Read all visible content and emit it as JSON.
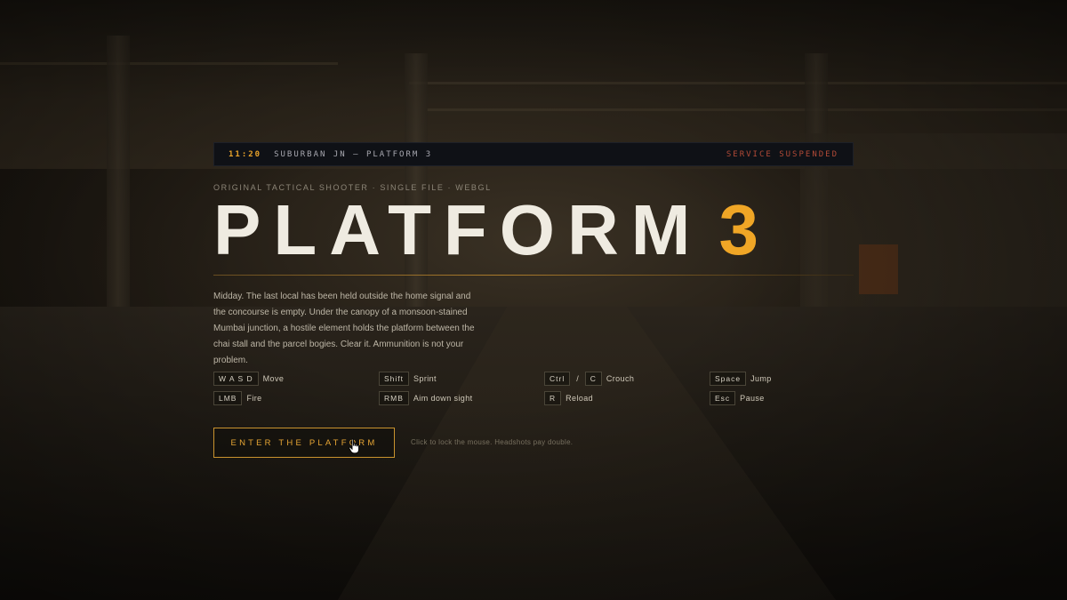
{
  "ticker": {
    "time": "11:20",
    "station": "SUBURBAN JN — PLATFORM 3",
    "status": "SERVICE SUSPENDED"
  },
  "kicker": "ORIGINAL TACTICAL SHOOTER · SINGLE FILE · WEBGL",
  "title": {
    "main": "PLATFORM",
    "number": "3"
  },
  "description": "Midday. The last local has been held outside the home signal and the concourse is empty. Under the canopy of a monsoon-stained Mumbai junction, a hostile element holds the platform between the chai stall and the parcel bogies. Clear it. Ammunition is not your problem.",
  "controls": [
    {
      "keys": [
        "W A S D"
      ],
      "action": "Move"
    },
    {
      "keys": [
        "Shift"
      ],
      "action": "Sprint"
    },
    {
      "keys": [
        "Ctrl",
        "C"
      ],
      "separator": "/",
      "action": "Crouch"
    },
    {
      "keys": [
        "Space"
      ],
      "action": "Jump"
    },
    {
      "keys": [
        "LMB"
      ],
      "action": "Fire"
    },
    {
      "keys": [
        "RMB"
      ],
      "action": "Aim down sight"
    },
    {
      "keys": [
        "R"
      ],
      "action": "Reload"
    },
    {
      "keys": [
        "Esc"
      ],
      "action": "Pause"
    }
  ],
  "cta": {
    "label": "ENTER THE PLATFORM"
  },
  "hint": "Click to lock the mouse. Headshots pay double.",
  "colors": {
    "accent": "#f0a626",
    "alert": "#b24a37",
    "text": "#efebe1"
  },
  "icons": {
    "cursor": "hand-pointer-icon"
  }
}
